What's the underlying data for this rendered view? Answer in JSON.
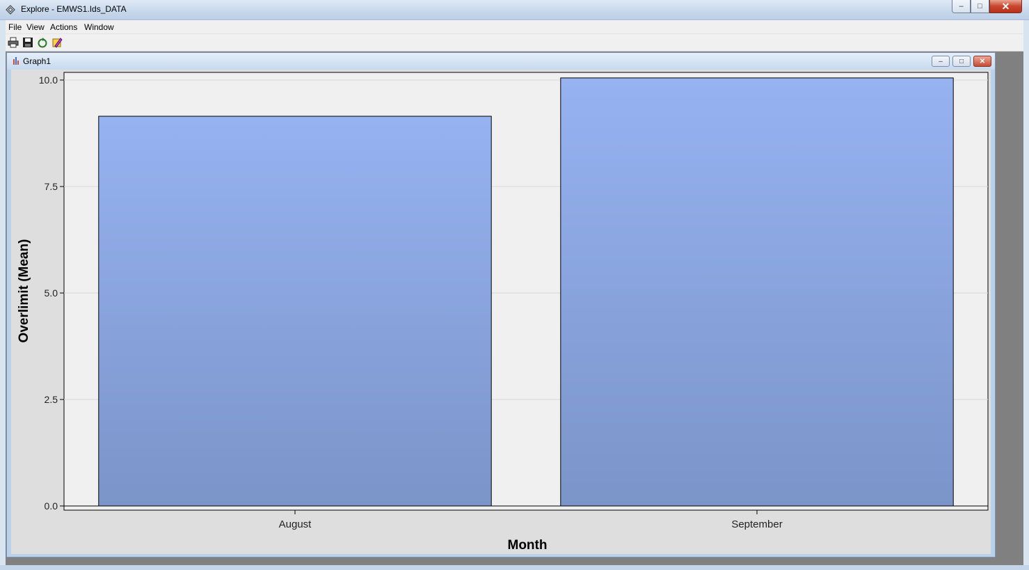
{
  "window": {
    "title": "Explore - EMWS1.Ids_DATA"
  },
  "menu": {
    "items": [
      "File",
      "View",
      "Actions",
      "Window"
    ]
  },
  "toolbar": {
    "icons": [
      "print-icon",
      "save-icon",
      "refresh-icon",
      "properties-icon"
    ]
  },
  "graph_window": {
    "title": "Graph1"
  },
  "colors": {
    "bar_top": "#96b2f1",
    "bar_bottom": "#7b95c9",
    "plot_bg": "#f0f0f0",
    "frame_bg": "#dedede"
  },
  "chart_data": {
    "type": "bar",
    "categories": [
      "August",
      "September"
    ],
    "values": [
      9.15,
      10.05
    ],
    "xlabel": "Month",
    "ylabel": "Overlimit (Mean)",
    "ylim": [
      0,
      10.2
    ],
    "yticks": [
      "0.0",
      "2.5",
      "5.0",
      "7.5",
      "10.0"
    ],
    "ytick_values": [
      0,
      2.5,
      5.0,
      7.5,
      10.0
    ],
    "grid": true
  }
}
